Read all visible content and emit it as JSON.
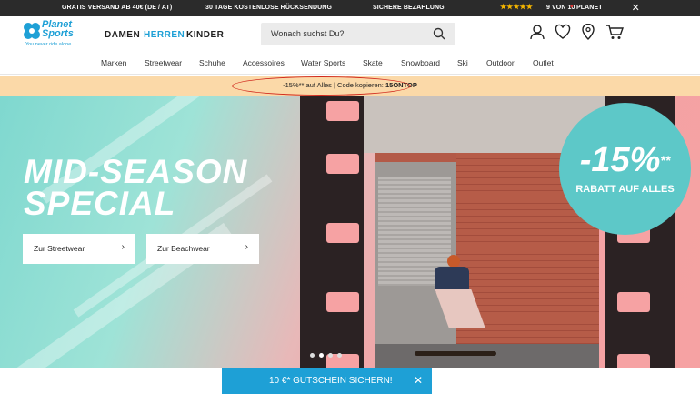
{
  "topbar": {
    "shipping": "GRATIS VERSAND AB 40€ (DE / AT)",
    "returns": "30 TAGE KOSTENLOSE RÜCKSENDUNG",
    "payment": "SICHERE BEZAHLUNG",
    "stars": "★★★★★",
    "rating": "9 VON 10",
    "rating_brand": "PLANET",
    "close": "✕"
  },
  "header": {
    "logo_word": "Planet Sports",
    "logo_tagline": "You never ride alone.",
    "genders": [
      "DAMEN",
      "HERREN",
      "KINDER"
    ],
    "search_placeholder": "Wonach suchst Du?"
  },
  "nav": {
    "items": [
      "Marken",
      "Streetwear",
      "Schuhe",
      "Accessoires",
      "Water Sports",
      "Skate",
      "Snowboard",
      "Ski",
      "Outdoor",
      "Outlet"
    ]
  },
  "promo": {
    "text": "-15%** auf Alles | Code kopieren: ",
    "code": "15ONTOP"
  },
  "hero": {
    "headline_1": "MID-SEASON",
    "headline_2": "SPECIAL",
    "cta_streetwear": "Zur Streetwear",
    "cta_beachwear": "Zur Beachwear",
    "cta_arrow": "›",
    "badge_percent": "-15%",
    "badge_sup": "**",
    "badge_text": "RABATT AUF ALLES"
  },
  "voucher": {
    "text": "10 €* GUTSCHEIN SICHERN!",
    "close": "✕"
  },
  "colors": {
    "brand": "#1ea0d6",
    "promo_bg": "#fbd9a8",
    "badge": "#5dc8c8",
    "topbar": "#2b2b2b"
  }
}
